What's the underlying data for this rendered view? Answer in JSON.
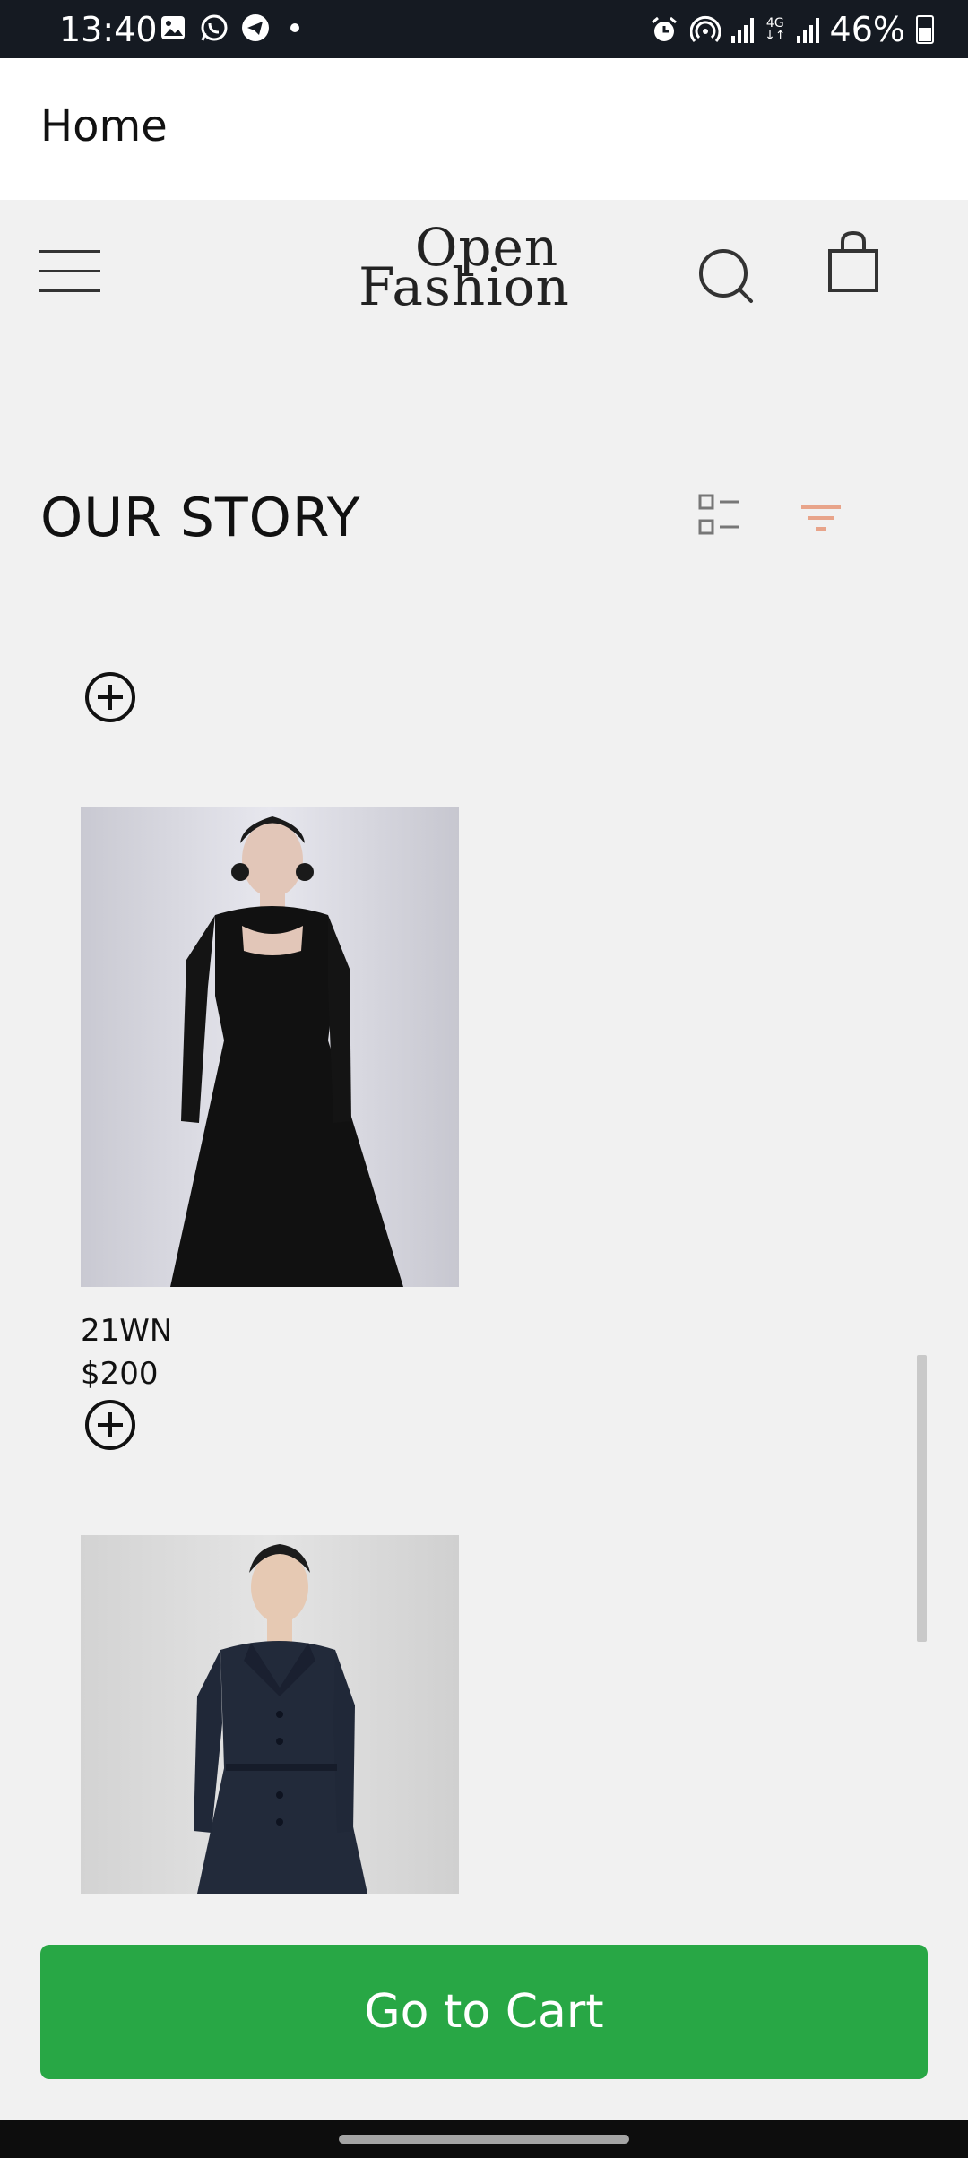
{
  "status_bar": {
    "time": "13:40",
    "left_icons": [
      "image-icon",
      "whatsapp-icon",
      "telegram-icon",
      "dot-icon"
    ],
    "right_icons": [
      "alarm-icon",
      "hotspot-icon",
      "signal-icon",
      "network-4g-icon",
      "signal-icon"
    ],
    "network_label": "4G",
    "battery": "46%"
  },
  "app_bar": {
    "title": "Home"
  },
  "header": {
    "logo_line1": "Open",
    "logo_line2": "Fashion",
    "icons": [
      "menu-icon",
      "search-icon",
      "shopping-bag-icon"
    ]
  },
  "section": {
    "title": "OUR STORY",
    "icons": [
      "list-view-icon",
      "filter-icon"
    ],
    "accent_color": "#e8a48a"
  },
  "products": [
    {
      "name": "21WN",
      "price": "$200",
      "image": "woman in black long-sleeve midi dress"
    },
    {
      "name": "",
      "price": "",
      "image": "woman in navy collared button-front dress"
    }
  ],
  "cart_button": {
    "label": "Go to Cart",
    "color": "#28a745"
  }
}
